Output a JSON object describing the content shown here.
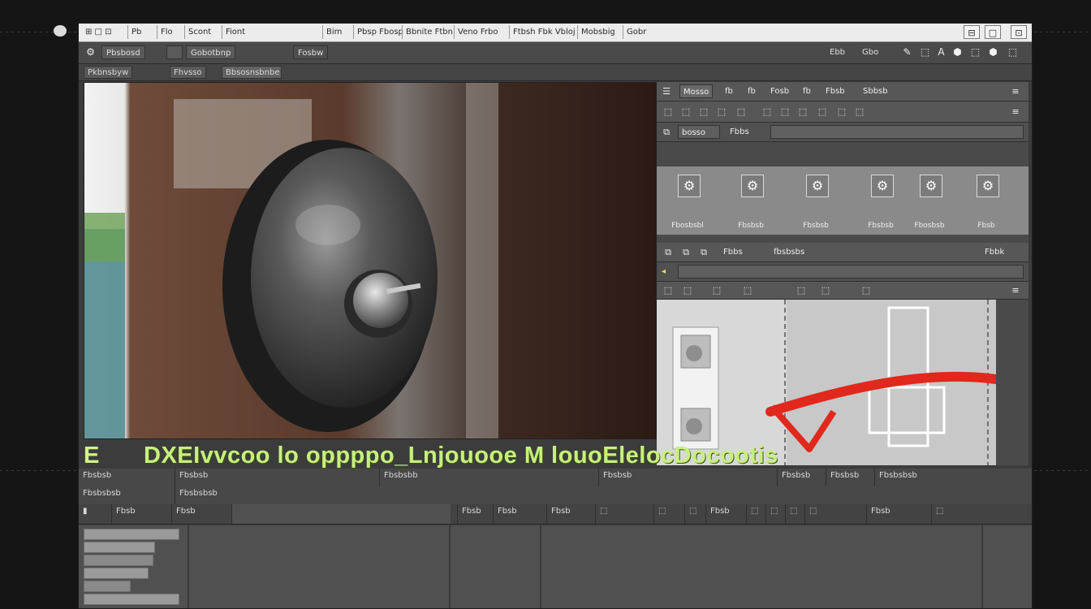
{
  "titlebar": {
    "segments": [
      "⊞ □ ⊡",
      "Pb",
      "Flo",
      "Scont",
      "Fiont",
      "Bim",
      "Pbsp Fbosp",
      "Bbnite Ftbn",
      "Veno Frbo",
      "Ftbsh Fbk Vbloj",
      "Mobsbig",
      "Gobr"
    ],
    "btn_min": "⊟",
    "btn_max": "□",
    "btn_close": "⊡"
  },
  "toolbar": {
    "left_label": "Pbsbosd",
    "mid_label": "Gobotbnp",
    "mid2_label": "Fosbw",
    "right_text": "Ebb",
    "right_label": "Gbo",
    "right_icons": [
      "✎",
      "⬚",
      "A",
      "⬢",
      "⬚",
      "⬢",
      "⬚"
    ]
  },
  "subtoolbar": {
    "label1": "Pkbnsbyw",
    "label2": "Fhvsso",
    "label3": "Bbsosnsbnbe"
  },
  "panel": {
    "row1": {
      "label": "Mosso",
      "labels": [
        "fb",
        "fb",
        "Fosb",
        "fb",
        "Fbsb",
        "Sbbsb"
      ]
    },
    "row2": {
      "icons": [
        "⬚",
        "⬚",
        "⬚",
        "⬚",
        "⬚",
        "⬚",
        "⬚",
        "⬚",
        "⬚",
        "⬚",
        "⬚"
      ]
    },
    "row3": {
      "label": "bosso",
      "label2": "Fbbs"
    },
    "thumbs": [
      {
        "icon": "⚙",
        "label": "Fbosbsbl"
      },
      {
        "icon": "⚙",
        "label": "Fbsbsb"
      },
      {
        "icon": "⚙",
        "label": "Fbsbsb"
      },
      {
        "icon": "⚙",
        "label": "Fbsbsb"
      },
      {
        "icon": "⚙",
        "label": "Fbosbsb"
      },
      {
        "icon": "⚙",
        "label": "Fbsb"
      }
    ],
    "row4": {
      "label": "Fbbs",
      "label2": "fbsbsbs",
      "right": "Fbbk"
    },
    "row5": {
      "label": "◂"
    },
    "row6": {
      "icons": [
        "⬚",
        "⬚",
        "⬚",
        "⬚",
        "⬚",
        "⬚",
        "⬚"
      ]
    }
  },
  "banner": {
    "prefix": "E",
    "text": "DXEIvvcoo lo oppppo_Lnjouooe M louoElelocDocootis"
  },
  "track_row1": {
    "label": "Fbsbsb",
    "label2": "Fbsbsb",
    "cells": [
      "Fbsbsbb",
      "Fbsbsb",
      "Fbsbsb",
      "Fbsbsb",
      "Fbsbsbsb"
    ]
  },
  "track_row2": {
    "label": "Fbsbsbsb",
    "label2": "Fbsbsbsb"
  },
  "transport": {
    "label1": "Fbsb",
    "label2": "Fbsb",
    "label3": "Fbsb",
    "playhead": "Fbsb",
    "zoom": "Fbsb",
    "right1": "Fbsb",
    "right2": "Fbsb",
    "icons": [
      "▮",
      "⬚",
      "⬚",
      "⬚",
      "⬚",
      "⬚",
      "⬚",
      "⬚",
      "⬚"
    ]
  },
  "tracks": [
    "",
    "",
    "",
    "",
    "",
    ""
  ]
}
